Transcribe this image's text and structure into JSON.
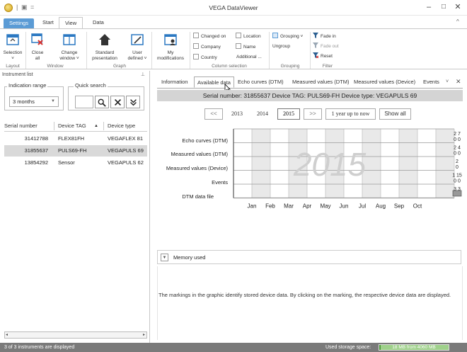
{
  "window": {
    "title": "VEGA DataViewer",
    "minimize": "–",
    "maximize": "□",
    "close": "✕"
  },
  "quick_access": {
    "save": "▣",
    "dropdown": "="
  },
  "ribbon_tabs": {
    "settings": "Settings",
    "start": "Start",
    "view": "View",
    "data": "Data",
    "collapse": "^"
  },
  "ribbon": {
    "layout": {
      "selection": "Selection",
      "selection_sub": "˅",
      "group": "Layout"
    },
    "window": {
      "close": "Close",
      "close_sub": "all",
      "change": "Change",
      "change_sub": "window ˅",
      "group": "Window"
    },
    "graph": {
      "standard": "Standard",
      "standard_sub": "presentation",
      "user": "User",
      "user_sub": "defined ˅",
      "group": "Graph"
    },
    "modifications": {
      "my": "My",
      "my_sub": "modifications"
    },
    "column_selection": {
      "items": [
        "Changed on",
        "Location",
        "Company",
        "Name",
        "Country",
        "Additional ..."
      ],
      "group": "Column selection"
    },
    "grouping": {
      "grouping": "Grouping ˅",
      "ungroup": "Ungroup",
      "group": "Grouping"
    },
    "filter": {
      "fade_in": "Fade in",
      "fade_out": "Fade out",
      "reset": "Reset",
      "group": "Filter"
    }
  },
  "left_panel": {
    "title": "Instrument list",
    "pin": "⊥",
    "indication_range": {
      "legend": "Indication range",
      "value": "3 months"
    },
    "quick_search": {
      "legend": "Quick search",
      "value": ""
    },
    "columns": [
      "Serial number",
      "Device TAG",
      "Device type"
    ],
    "sort_arrow": "▲",
    "rows": [
      {
        "serial": "31412788",
        "tag": "FLEX81FH",
        "type": "VEGAFLEX 81"
      },
      {
        "serial": "31855637",
        "tag": "PULS69-FH",
        "type": "VEGAPULS 69"
      },
      {
        "serial": "13854292",
        "tag": "Sensor",
        "type": "VEGAPULS 62"
      }
    ]
  },
  "detail": {
    "tabs": [
      "Information",
      "Available data",
      "Echo curves (DTM)",
      "Measured values (DTM)",
      "Measured values (Device)",
      "Events"
    ],
    "tab_more": "˅",
    "tab_close": "✕",
    "serial_bar": "Serial number: 31855637   Device TAG: PULS69-FH   Device type: VEGAPULS 69",
    "year_nav": {
      "prev": "<<",
      "years": [
        "2013",
        "2014",
        "2015"
      ],
      "next": ">>",
      "range": "1 year up to now",
      "show_all": "Show all"
    },
    "chart": {
      "watermark": "2015",
      "rows": [
        "Echo curves (DTM)",
        "Measured values (DTM)",
        "Measured values (Device)",
        "Events",
        "DTM data file"
      ],
      "months": [
        "Jan",
        "Feb",
        "Mar",
        "Apr",
        "May",
        "Jun",
        "Jul",
        "Aug",
        "Sep",
        "Oct"
      ],
      "markers": [
        {
          "top": "2 7",
          "bottom": "0 0"
        },
        {
          "top": "2 4",
          "bottom": "0 0"
        },
        {
          "top": "2",
          "bottom": "0"
        },
        {
          "top": "1 15",
          "bottom": "0 0"
        },
        {
          "top": "3 3",
          "bottom": ""
        }
      ]
    },
    "description": "The markings in the graphic identify stored device data. By clicking on the marking, the respective device data are displayed.",
    "memory": {
      "toggle": "▼",
      "label": "Memory used"
    }
  },
  "status": {
    "left": "3 of 3 instruments are displayed",
    "storage_label": "Used storage space:",
    "storage_value": "18 MB from 4060 MB",
    "storage_fraction": 0.0044
  },
  "colors": {
    "accent": "#5b9bd5",
    "status_bar": "#7a7a7a",
    "storage_fill": "#4d9b3a"
  }
}
